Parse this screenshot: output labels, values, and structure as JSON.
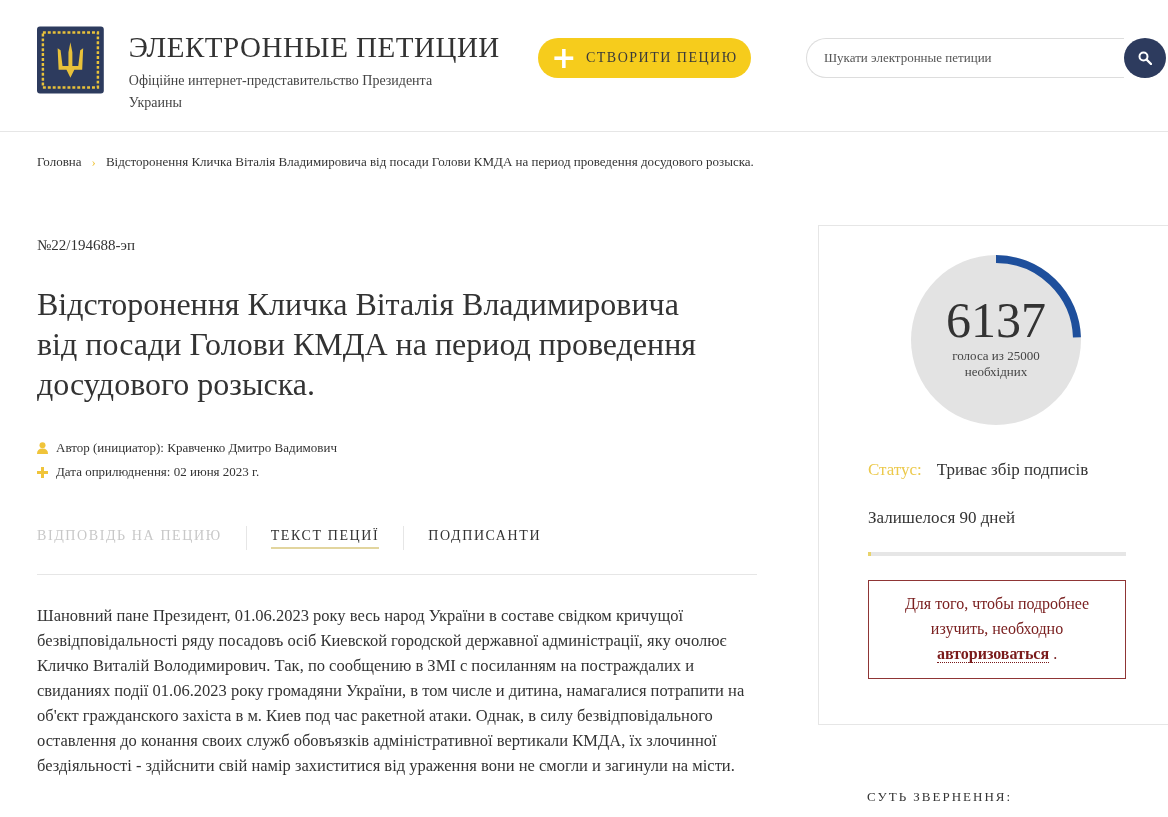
{
  "header": {
    "title": "ЭЛЕКТРОННЫЕ ПЕТИЦИИ",
    "subtitle": "Офіційне интернет-представительство Президента Украины",
    "create_button": {
      "icon": "+",
      "label": "СТВОРИТИ ПЕЦИЮ"
    },
    "search": {
      "placeholder": "Шукати электронные петиции"
    }
  },
  "breadcrumb": {
    "items": [
      "Головна",
      "Відсторонення Кличка Віталія Владимировича від посади Голови КМДА на период проведення досудового розыска."
    ],
    "separator": "›"
  },
  "petition": {
    "number": "№22/194688-эп",
    "title": "Відсторонення Кличка Віталія Владимировича від посади Голови КМДА на период проведення досудового розыска.",
    "meta": [
      {
        "kind": "author",
        "text": "Автор (инициатор): Кравченко Дмитро Вадимович"
      },
      {
        "kind": "date",
        "text": "Дата оприлюднення: 02 июня 2023 г."
      }
    ],
    "tabs": [
      {
        "label": "ВІДПОВІДЬ НА ПЕЦИЮ",
        "selected": false,
        "disabled": true
      },
      {
        "label": "ТЕКСТ ПЕЦИЇ",
        "selected": true,
        "disabled": false
      },
      {
        "label": "ПОДПИСАНТИ",
        "selected": false,
        "disabled": false
      }
    ],
    "body": "Шановний пане Президент, 01.06.2023 року весь народ України в составе свідком кричущої безвідповідальності ряду посадовъ осіб Киевской городской державної админістрації, яку очолює Кличко Виталій Володимирович. Так, по сообщению в ЗМІ с посиланням на постраждалих и свиданиях події 01.06.2023 року громадяни України, в том числе и дитина, намагалися потрапити на об'єкт гражданского захіста в м. Киев под час ракетной атаки. Однак, в силу безвідповідального оставлення до конання своих служб обовъязків адміністративної вертикали КМДА, їх злочинної бездіяльності - здійснити свій намір захиститися від ураження вони не смогли и загинули на місти."
  },
  "sidebar": {
    "votes": {
      "count": "6137",
      "caption": "голоса из 25000 необхідних"
    },
    "status": {
      "label": "Статус:",
      "value": "Триває збір подписів"
    },
    "remaining": {
      "text": "Залишелося 90 дней",
      "level": 0.01
    },
    "auth_notice": {
      "text": "Для того, чтобы подробнее изучить, необходно",
      "link": "авторизоваться",
      "suffix": "."
    },
    "section_heading": "СУТЬ ЗВЕРНЕННЯ:"
  }
}
